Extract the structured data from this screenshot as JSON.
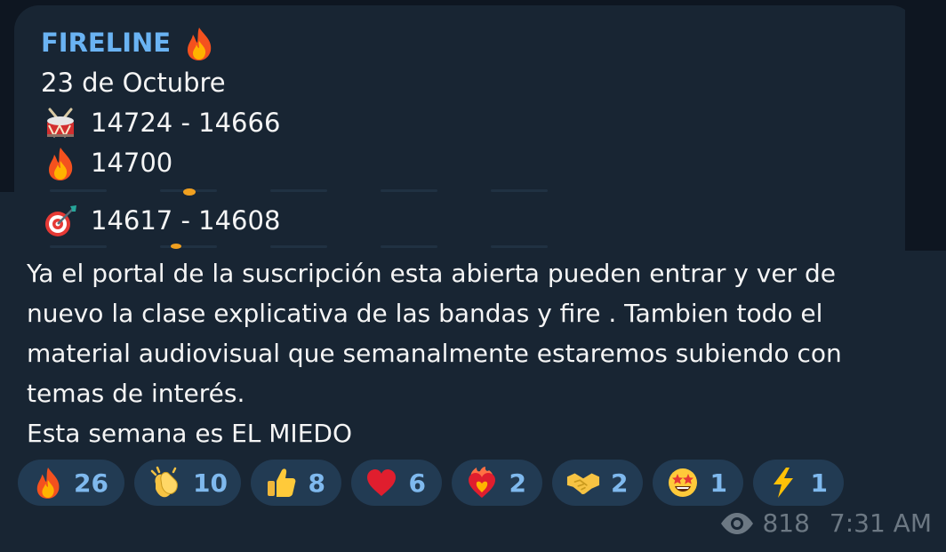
{
  "message": {
    "title": "FIRELINE",
    "title_icon": "fire-icon",
    "date": "23 de Octubre",
    "lines": [
      {
        "icon": "drum-icon",
        "text": "14724 - 14666"
      },
      {
        "icon": "fire-icon",
        "text": "14700"
      },
      {
        "icon": "target-icon",
        "text": "14617 - 14608"
      }
    ],
    "body_lines": [
      "Ya el portal de la suscripción esta abierta pueden entrar y ver de",
      "nuevo la clase explicativa de las bandas y fire . Tambien todo el",
      "material audiovisual que semanalmente estaremos subiendo con",
      "temas de interés.",
      "Esta semana es EL MIEDO"
    ]
  },
  "reactions": [
    {
      "icon": "fire-icon",
      "count": "26"
    },
    {
      "icon": "clapping-hands-icon",
      "count": "10"
    },
    {
      "icon": "thumbs-up-icon",
      "count": "8"
    },
    {
      "icon": "red-heart-icon",
      "count": "6"
    },
    {
      "icon": "heart-on-fire-icon",
      "count": "2"
    },
    {
      "icon": "handshake-icon",
      "count": "2"
    },
    {
      "icon": "star-struck-icon",
      "count": "1"
    },
    {
      "icon": "lightning-icon",
      "count": "1"
    }
  ],
  "footer": {
    "views_icon": "eye-icon",
    "views": "818",
    "time": "7:31 AM"
  },
  "colors": {
    "window_bg": "#0e1621",
    "bubble_bg": "#182533",
    "title": "#6ab3f3",
    "reaction_bg": "#223b53",
    "reaction_text": "#7fb9ee",
    "meta_text": "#6c7883"
  }
}
